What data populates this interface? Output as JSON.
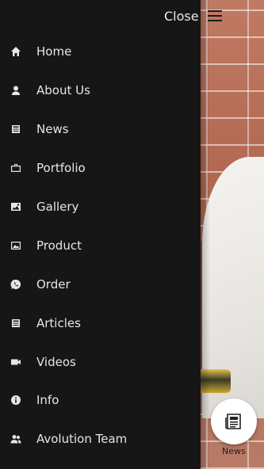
{
  "header": {
    "close_label": "Close",
    "menu_icon": "hamburger-icon"
  },
  "menu": {
    "items": [
      {
        "label": "Home",
        "icon": "home-icon"
      },
      {
        "label": "About Us",
        "icon": "user-icon"
      },
      {
        "label": "News",
        "icon": "news-icon"
      },
      {
        "label": "Portfolio",
        "icon": "briefcase-icon"
      },
      {
        "label": "Gallery",
        "icon": "gallery-icon"
      },
      {
        "label": "Product",
        "icon": "image-icon"
      },
      {
        "label": "Order",
        "icon": "whatsapp-icon"
      },
      {
        "label": "Articles",
        "icon": "articles-icon"
      },
      {
        "label": "Videos",
        "icon": "video-icon"
      },
      {
        "label": "Info",
        "icon": "info-icon"
      },
      {
        "label": "Avolution Team",
        "icon": "team-icon"
      }
    ]
  },
  "fab": {
    "label": "News",
    "icon": "newspaper-icon"
  },
  "colors": {
    "drawer_bg": "#161616",
    "menu_text": "#e6e6e6",
    "fab_bg": "#ffffff"
  }
}
